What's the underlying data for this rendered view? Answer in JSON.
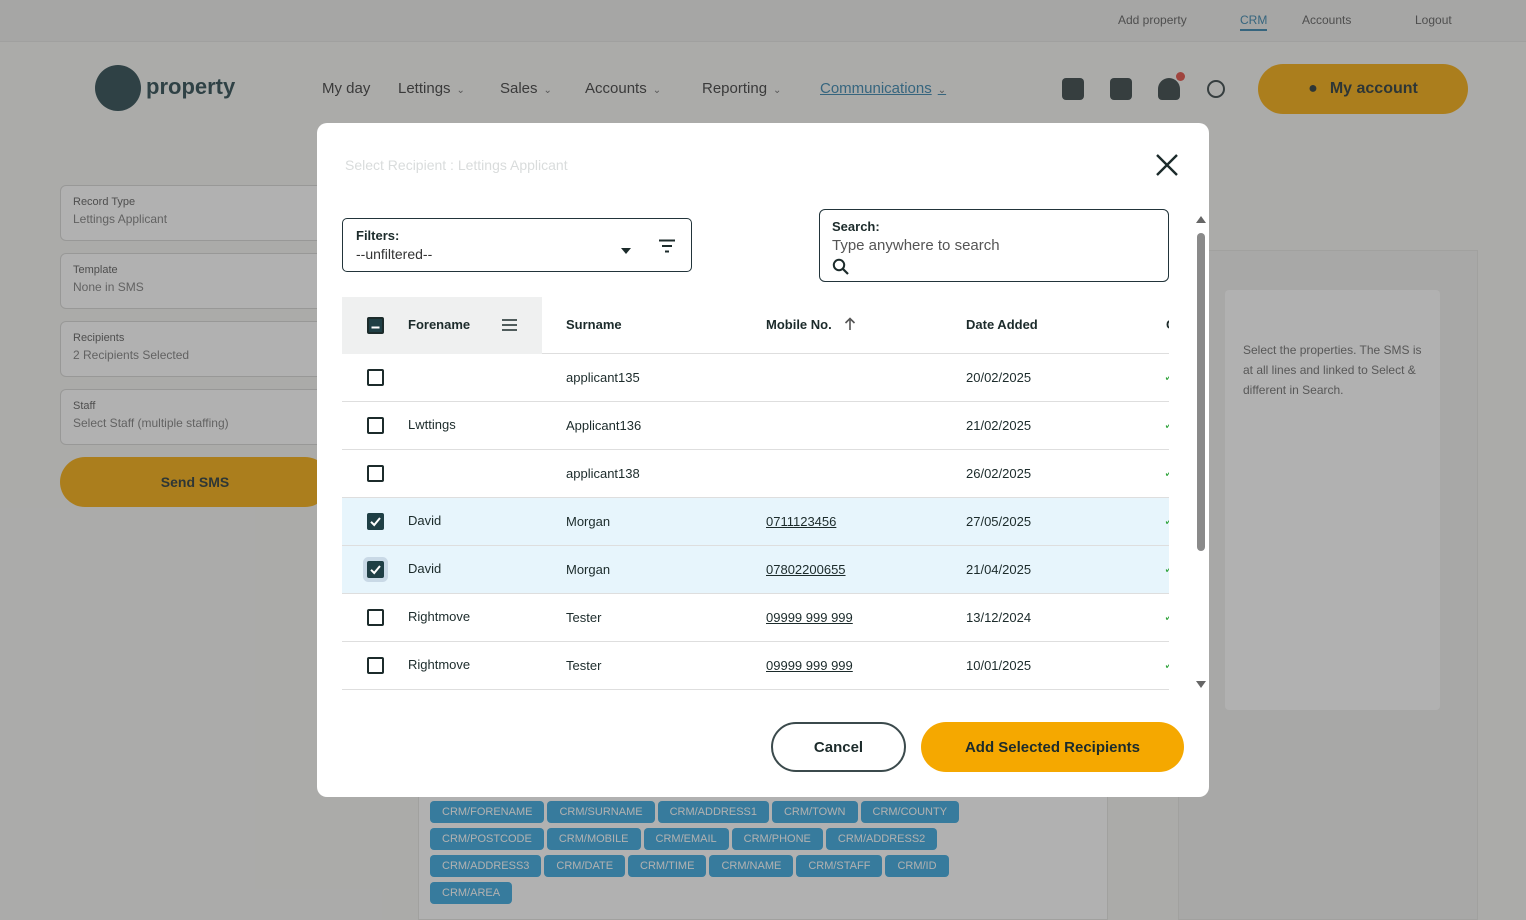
{
  "topbar": {
    "links": [
      "Add property",
      "CRM",
      "Accounts",
      "Logout"
    ]
  },
  "header": {
    "logo_text": "property",
    "nav": [
      {
        "label": "My day"
      },
      {
        "label": "Lettings"
      },
      {
        "label": "Sales"
      },
      {
        "label": "Accounts"
      },
      {
        "label": "Reporting"
      },
      {
        "label": "Communications"
      }
    ],
    "account_label": "My account"
  },
  "left_form": {
    "fields": [
      {
        "label": "Record Type",
        "value": "Lettings Applicant"
      },
      {
        "label": "Template",
        "value": "None in SMS"
      },
      {
        "label": "Recipients",
        "value": "2 Recipients Selected"
      },
      {
        "label": "Staff",
        "value": "Select Staff (multiple staffing)"
      }
    ],
    "send_label": "Send SMS"
  },
  "right_card": {
    "text": "Select the properties. The SMS is at all lines and linked to Select & different in Search."
  },
  "tags": [
    "CRM/FORENAME",
    "CRM/SURNAME",
    "CRM/ADDRESS1",
    "CRM/TOWN",
    "CRM/COUNTY",
    "CRM/POSTCODE",
    "CRM/MOBILE",
    "CRM/EMAIL",
    "CRM/PHONE",
    "CRM/ADDRESS2",
    "CRM/ADDRESS3",
    "CRM/DATE",
    "CRM/TIME",
    "CRM/NAME",
    "CRM/STAFF",
    "CRM/ID",
    "CRM/AREA"
  ],
  "modal": {
    "title": "Select Recipient : Lettings Applicant",
    "filters": {
      "label": "Filters:",
      "value": "--unfiltered--"
    },
    "search": {
      "label": "Search:",
      "placeholder": "Type anywhere to search"
    },
    "columns": [
      "Forename",
      "Surname",
      "Mobile No.",
      "Date Added"
    ],
    "rows": [
      {
        "forename": "",
        "surname": "applicant135",
        "mobile": "",
        "date": "20/02/2025",
        "checked": false
      },
      {
        "forename": "Lwttings",
        "surname": "Applicant136",
        "mobile": "",
        "date": "21/02/2025",
        "checked": false
      },
      {
        "forename": "",
        "surname": "applicant138",
        "mobile": "",
        "date": "26/02/2025",
        "checked": false
      },
      {
        "forename": "David",
        "surname": "Morgan",
        "mobile": "0711123456",
        "date": "27/05/2025",
        "checked": true
      },
      {
        "forename": "David",
        "surname": "Morgan",
        "mobile": "07802200655",
        "date": "21/04/2025",
        "checked": true
      },
      {
        "forename": "Rightmove",
        "surname": "Tester",
        "mobile": "09999 999 999",
        "date": "13/12/2024",
        "checked": false
      },
      {
        "forename": "Rightmove",
        "surname": "Tester",
        "mobile": "09999 999 999",
        "date": "10/01/2025",
        "checked": false
      }
    ],
    "cancel_label": "Cancel",
    "add_label": "Add Selected Recipients",
    "colors": {
      "accent": "#f5a800",
      "selected_row": "#e7f5fc",
      "checkbox": "#1f3f45"
    }
  }
}
